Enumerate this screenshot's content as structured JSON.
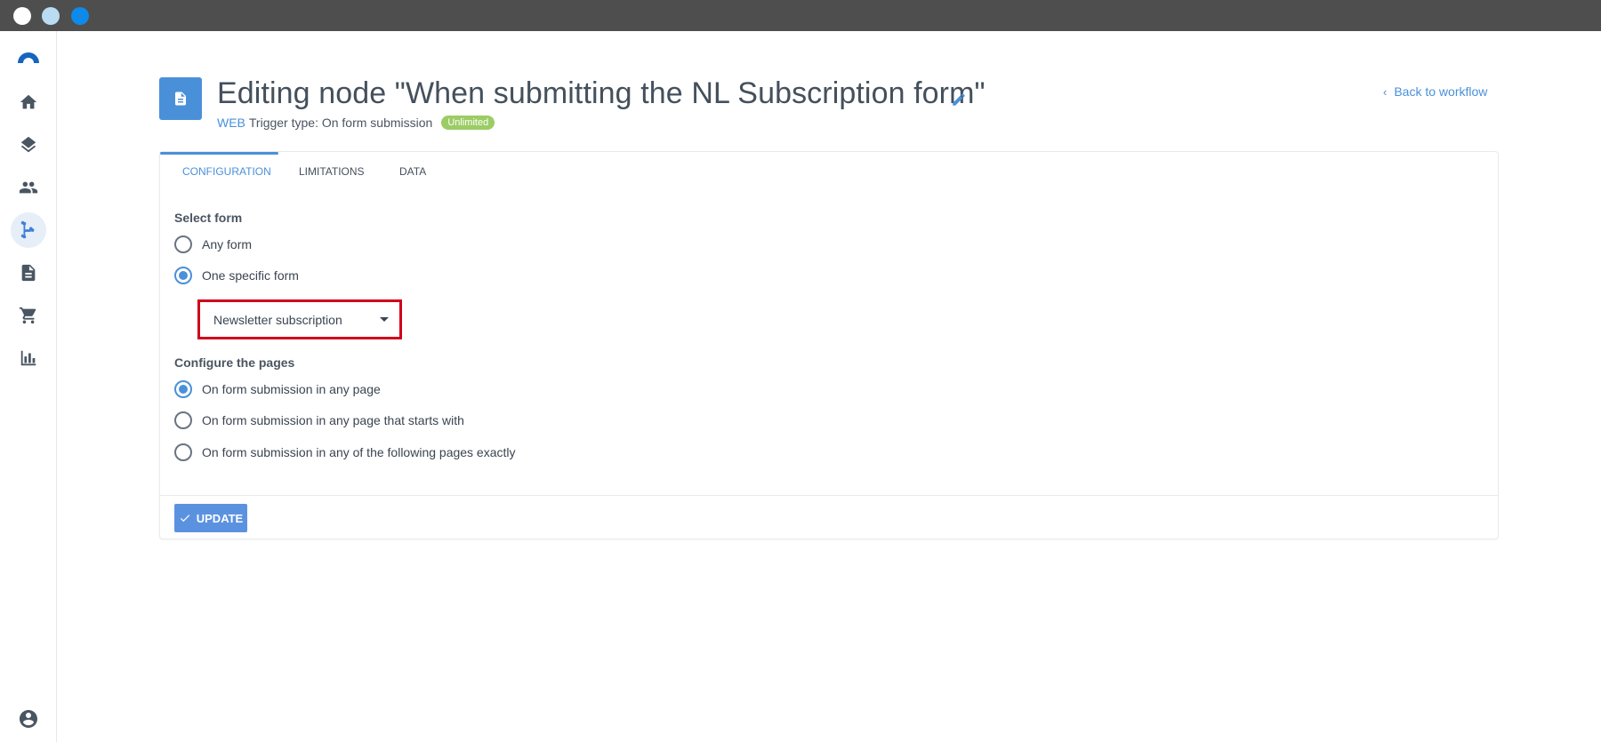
{
  "window": {
    "dots": [
      "close",
      "minimize",
      "maximize"
    ]
  },
  "sidebar": {
    "items": [
      {
        "name": "home",
        "icon": "home-icon",
        "active": false
      },
      {
        "name": "layers",
        "icon": "layers-icon",
        "active": false
      },
      {
        "name": "contacts",
        "icon": "people-icon",
        "active": false
      },
      {
        "name": "workflows",
        "icon": "workflow-icon",
        "active": true
      },
      {
        "name": "forms",
        "icon": "document-icon",
        "active": false
      },
      {
        "name": "ecommerce",
        "icon": "cart-icon",
        "active": false
      },
      {
        "name": "reports",
        "icon": "bar-chart-icon",
        "active": false
      }
    ],
    "footer_icon": "account-circle-icon"
  },
  "header": {
    "title": "Editing node \"When submitting the NL Subscription form\"",
    "subtitle_prefix": "WEB",
    "subtitle_trigger": "Trigger type: On form submission",
    "badge": "Unlimited",
    "back_link": "Back to workflow"
  },
  "tabs": [
    {
      "label": "CONFIGURATION",
      "active": true
    },
    {
      "label": "LIMITATIONS",
      "active": false
    },
    {
      "label": "DATA",
      "active": false
    }
  ],
  "select_form": {
    "label": "Select form",
    "options": [
      {
        "label": "Any form",
        "checked": false
      },
      {
        "label": "One specific form",
        "checked": true
      }
    ],
    "dropdown_value": "Newsletter subscription"
  },
  "configure_pages": {
    "label": "Configure the pages",
    "options": [
      {
        "label": "On form submission in any page",
        "checked": true
      },
      {
        "label": "On form submission in any page that starts with",
        "checked": false
      },
      {
        "label": "On form submission in any of the following pages exactly",
        "checked": false
      }
    ]
  },
  "actions": {
    "update_label": "UPDATE"
  },
  "colors": {
    "accent": "#4a90d9",
    "badge": "#9ccc65",
    "highlight_border": "#d0021b",
    "titlebar": "#4e4e4e"
  }
}
